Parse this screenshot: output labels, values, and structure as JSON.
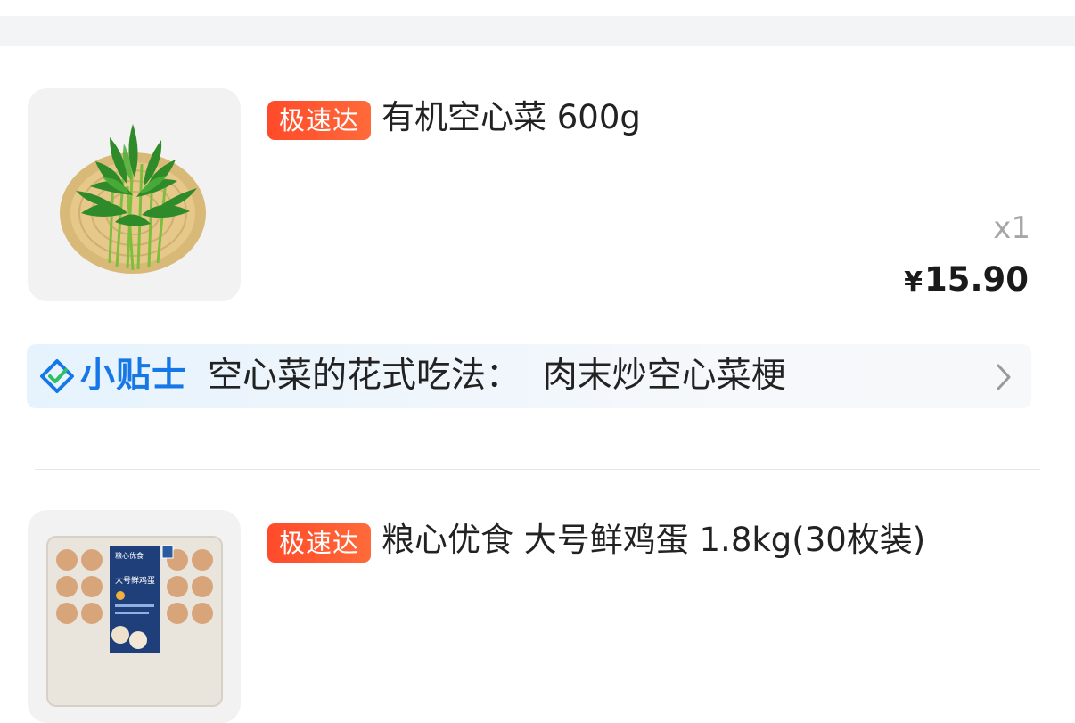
{
  "orders": [
    {
      "badge": "极速达",
      "title": "有机空心菜 600g",
      "image_icon": "water-spinach-image",
      "quantity": "x1",
      "price_symbol": "¥",
      "price": "15.90"
    },
    {
      "badge": "极速达",
      "title": "粮心优食 大号鲜鸡蛋 1.8kg(30枚装)",
      "image_icon": "egg-carton-image",
      "package_brand": "粮心优食",
      "package_title": "大号鲜鸡蛋"
    }
  ],
  "tip": {
    "icon": "check-diamond-icon",
    "brand": "小贴士",
    "text": "空心菜的花式吃法：  肉末炒空心菜梗",
    "chevron": "chevron-right-icon"
  },
  "colors": {
    "badge": "#ff4a2a",
    "tip_brand": "#1677e6",
    "tip_background": "#e6f3fd",
    "muted": "#a6a6a6"
  }
}
